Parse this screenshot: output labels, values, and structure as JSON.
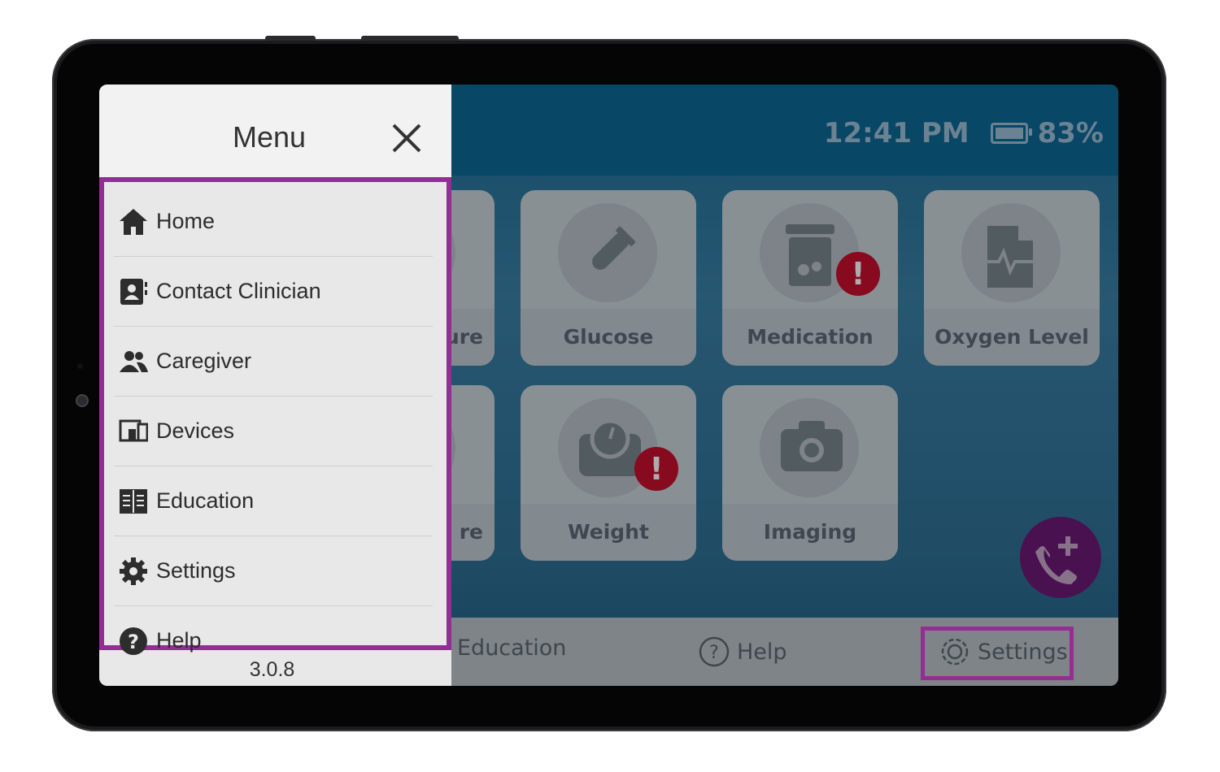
{
  "status": {
    "time": "12:41 PM",
    "battery": "83%"
  },
  "tiles": [
    {
      "label": "ure",
      "icon": "thermometer-icon"
    },
    {
      "label": "Glucose",
      "icon": "test-tube-icon"
    },
    {
      "label": "Medication",
      "icon": "pill-bottle-icon",
      "alert": "!"
    },
    {
      "label": "Oxygen Level",
      "icon": "oxygen-report-icon"
    },
    {
      "label": "re",
      "icon": "pressure-icon"
    },
    {
      "label": "Weight",
      "icon": "scale-icon",
      "alert": "!"
    },
    {
      "label": "Imaging",
      "icon": "camera-icon"
    }
  ],
  "bottom_nav": {
    "education": "Education",
    "help": "Help",
    "settings": "Settings"
  },
  "menu": {
    "title": "Menu",
    "items": [
      {
        "label": "Home",
        "icon": "home-icon"
      },
      {
        "label": "Contact Clinician",
        "icon": "contact-card-icon"
      },
      {
        "label": "Caregiver",
        "icon": "people-icon"
      },
      {
        "label": "Devices",
        "icon": "devices-icon"
      },
      {
        "label": "Education",
        "icon": "book-icon"
      },
      {
        "label": "Settings",
        "icon": "gear-icon"
      },
      {
        "label": "Help",
        "icon": "question-icon"
      }
    ],
    "version": "3.0.8"
  },
  "colors": {
    "highlight": "#942e94",
    "alert": "#c8102e",
    "fab": "#6e1a78"
  }
}
